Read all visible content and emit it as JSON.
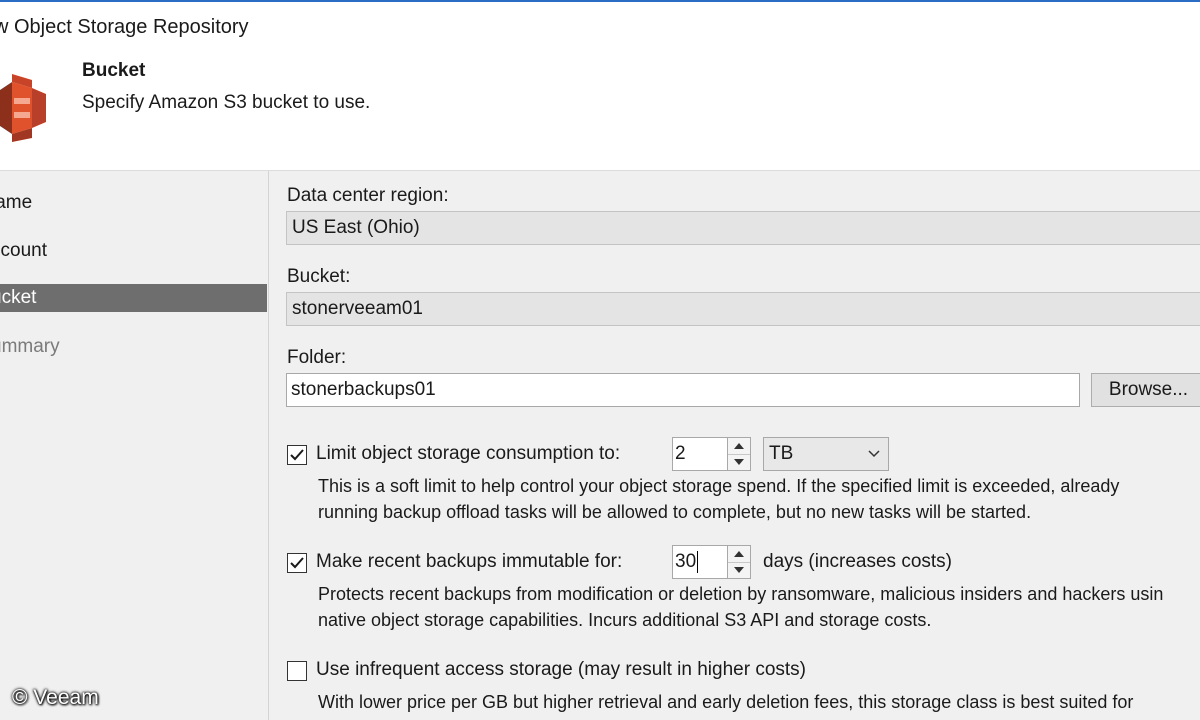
{
  "window": {
    "title": "w Object Storage Repository"
  },
  "header": {
    "icon": "amazon-s3-bucket-icon",
    "title": "Bucket",
    "subtitle": "Specify Amazon S3 bucket to use."
  },
  "steps": [
    {
      "label": "lame",
      "state": "done"
    },
    {
      "label": "ccount",
      "state": "done"
    },
    {
      "label": "ucket",
      "state": "active"
    },
    {
      "label": "ummary",
      "state": "pending"
    }
  ],
  "form": {
    "region_label": "Data center region:",
    "region_value": "US East (Ohio)",
    "bucket_label": "Bucket:",
    "bucket_value": "stonerveeam01",
    "folder_label": "Folder:",
    "folder_value": "stonerbackups01",
    "browse_label": "Browse...",
    "limit": {
      "checked": true,
      "label": "Limit object storage consumption to:",
      "value": "2",
      "unit": "TB",
      "desc_line1": "This is a soft limit to help control your object storage spend. If the specified limit is exceeded, already",
      "desc_line2": "running backup offload tasks will be allowed to complete, but no new tasks will be started."
    },
    "immutable": {
      "checked": true,
      "label": "Make recent backups immutable for:",
      "value": "30",
      "suffix": "days (increases costs)",
      "desc_line1": "Protects recent backups from modification or deletion by ransomware, malicious insiders and hackers usin",
      "desc_line2": "native object storage capabilities. Incurs additional S3 API and storage costs."
    },
    "infrequent": {
      "checked": false,
      "label": "Use infrequent access storage (may result in higher costs)",
      "desc_line1": "With lower price per GB but higher retrieval and early deletion fees, this storage class is best suited for"
    }
  },
  "watermark": "© Veeam",
  "colors": {
    "title_accent": "#2b6cc4",
    "s3_orange": "#e0522c",
    "active_step": "#6e6e6e",
    "panel_bg": "#f0f0f0"
  }
}
